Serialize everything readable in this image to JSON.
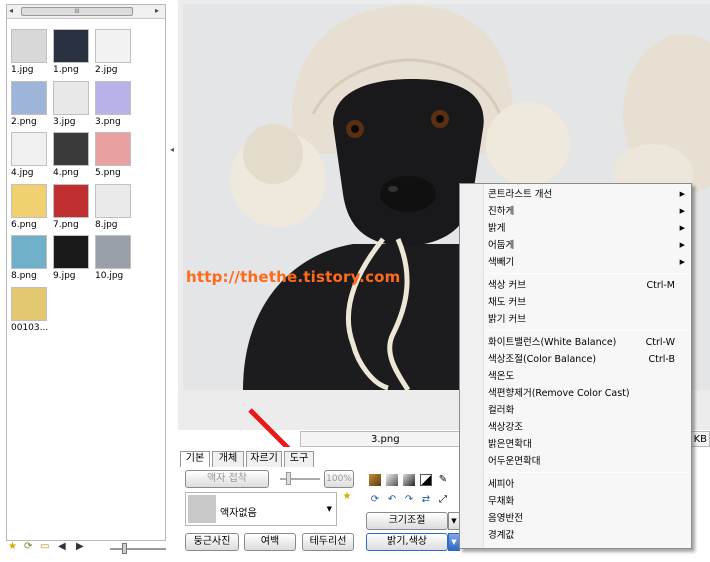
{
  "thumbnails": [
    {
      "label": "1.jpg"
    },
    {
      "label": "1.png"
    },
    {
      "label": "2.jpg"
    },
    {
      "label": "2.png"
    },
    {
      "label": "3.jpg"
    },
    {
      "label": "3.png"
    },
    {
      "label": "4.jpg"
    },
    {
      "label": "4.png"
    },
    {
      "label": "5.png"
    },
    {
      "label": "6.png"
    },
    {
      "label": "7.png"
    },
    {
      "label": "8.jpg"
    },
    {
      "label": "8.png"
    },
    {
      "label": "9.jpg"
    },
    {
      "label": "10.jpg"
    },
    {
      "label": "00103..."
    }
  ],
  "scrollbar": {
    "thumb_label": "III"
  },
  "viewer": {
    "watermark": "http://thethe.tistory.com",
    "file_name": "3.png",
    "file_size_suffix": "KB"
  },
  "panel": {
    "tabs": [
      "기본",
      "개체",
      "자르기",
      "도구"
    ],
    "frame_attach_label": "액자 접착",
    "opacity_label": "100%",
    "frame_select_label": "액자없음",
    "resize_label": "크기조절",
    "round_photo_label": "둥근사진",
    "margin_label": "여백",
    "border_label": "테두리선",
    "brightness_color_label": "밝기,색상"
  },
  "context_menu": {
    "groups": [
      [
        {
          "label": "콘트라스트 개선",
          "submenu": true
        },
        {
          "label": "진하게",
          "submenu": true
        },
        {
          "label": "밝게",
          "submenu": true
        },
        {
          "label": "어둡게",
          "submenu": true
        },
        {
          "label": "색빼기",
          "submenu": true
        }
      ],
      [
        {
          "label": "색상 커브",
          "shortcut": "Ctrl-M"
        },
        {
          "label": "채도 커브"
        },
        {
          "label": "밝기 커브"
        }
      ],
      [
        {
          "label": "화이트밸런스(White Balance)",
          "shortcut": "Ctrl-W"
        },
        {
          "label": "색상조절(Color Balance)",
          "shortcut": "Ctrl-B"
        },
        {
          "label": "색온도"
        },
        {
          "label": "색편향제거(Remove Color Cast)"
        },
        {
          "label": "컬러화"
        },
        {
          "label": "색상강조"
        },
        {
          "label": "밝은면확대"
        },
        {
          "label": "어두운면확대"
        }
      ],
      [
        {
          "label": "세피아"
        },
        {
          "label": "무채화"
        },
        {
          "label": "음영반전"
        },
        {
          "label": "경계값"
        }
      ]
    ]
  },
  "colors": {
    "watermark": "#ff6a1a",
    "arrow": "#e8191b",
    "highlight": "#3169c6"
  }
}
